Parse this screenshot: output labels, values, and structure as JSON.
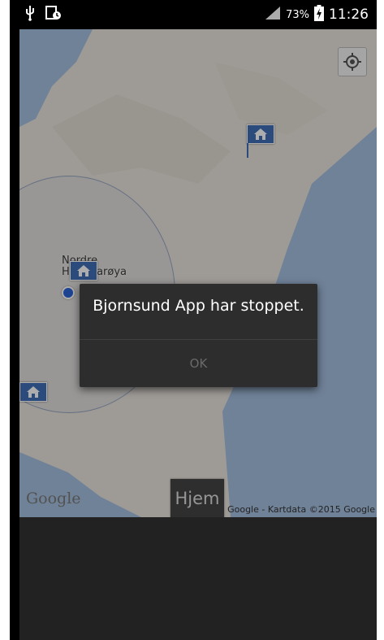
{
  "status_bar": {
    "usb_icon": "usb-icon",
    "screenshot_icon": "screenshot-icon",
    "signal_icon": "signal-icon",
    "battery_percent": "73%",
    "battery_icon": "battery-charging-icon",
    "time": "11:26"
  },
  "map": {
    "place_label_line1": "Nordre",
    "place_label_line2": "Hammarøya",
    "google_logo": "Google",
    "copyright": "©2015 Google - Kartdata ©2015 Google",
    "location_button_icon": "my-location-icon",
    "markers": [
      "house-marker-icon",
      "house-marker-icon",
      "house-marker-icon"
    ],
    "colors": {
      "land": "#e9e4dd",
      "water": "#a6c0e0",
      "marker": "#3f6fb7"
    }
  },
  "home_button": {
    "label": "Hjem"
  },
  "dialog": {
    "message": "Bjornsund App har stoppet.",
    "ok_label": "OK"
  }
}
